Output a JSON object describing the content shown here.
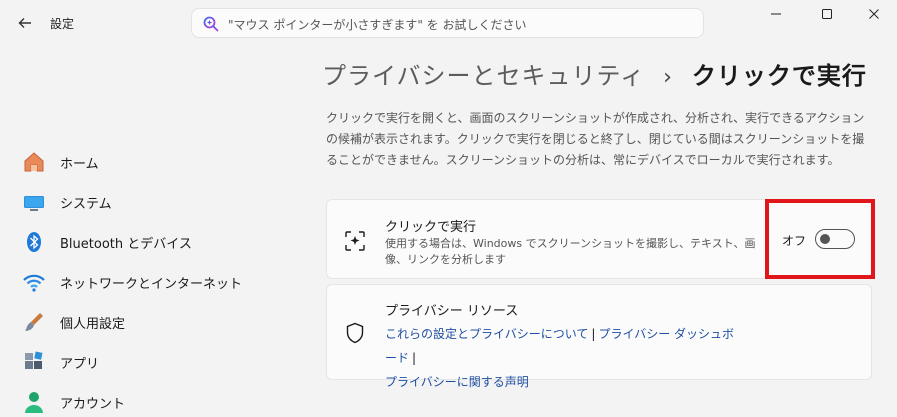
{
  "window": {
    "title": "設定",
    "back_icon": "back-arrow-icon",
    "controls": [
      "minimize-icon",
      "maximize-icon",
      "close-icon"
    ]
  },
  "search": {
    "placeholder": "\"マウス ポインターが小さすぎます\" を お試しください",
    "icon": "copilot-search-icon"
  },
  "sidebar": {
    "items": [
      {
        "label": "ホーム",
        "icon": "home-icon"
      },
      {
        "label": "システム",
        "icon": "system-monitor-icon"
      },
      {
        "label": "Bluetooth とデバイス",
        "icon": "bluetooth-icon"
      },
      {
        "label": "ネットワークとインターネット",
        "icon": "wifi-icon"
      },
      {
        "label": "個人用設定",
        "icon": "paintbrush-icon"
      },
      {
        "label": "アプリ",
        "icon": "apps-icon"
      },
      {
        "label": "アカウント",
        "icon": "account-icon"
      }
    ]
  },
  "breadcrumb": {
    "parent": "プライバシーとセキュリティ",
    "separator": "›",
    "current": "クリックで実行"
  },
  "description": "クリックで実行を開くと、画面のスクリーンショットが作成され、分析され、実行できるアクションの候補が表示されます。クリックで実行を閉じると終了し、閉じている間はスクリーンショットを撮ることができません。スクリーンショットの分析は、常にデバイスでローカルで実行されます。",
  "feature": {
    "title": "クリックで実行",
    "description": "使用する場合は、Windows でスクリーンショットを撮影し、テキスト、画像、リンクを分析します",
    "toggle_state_label": "オフ",
    "toggle_on": false,
    "icon": "click-to-do-icon"
  },
  "privacy": {
    "title": "プライバシー リソース",
    "icon": "shield-icon",
    "link1": "これらの設定とプライバシーについて",
    "link2": "プライバシー ダッシュボード",
    "link3": "プライバシーに関する声明",
    "separator": "|"
  },
  "colors": {
    "accent_link": "#1f4fa3",
    "highlight": "#e0161b",
    "background": "#f3f3f3",
    "card": "#fbfbfb"
  }
}
